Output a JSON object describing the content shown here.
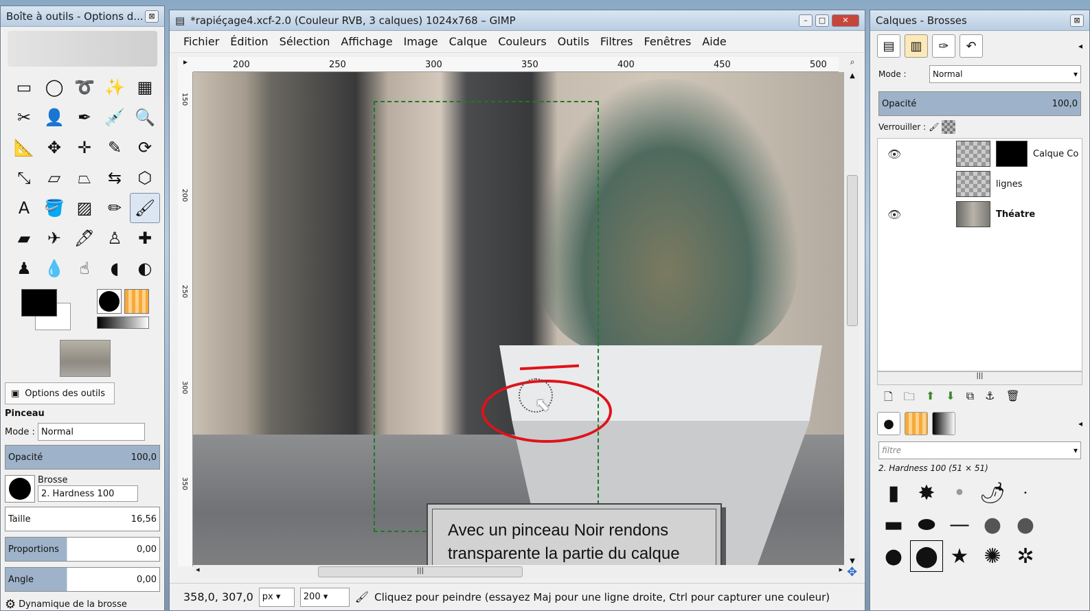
{
  "toolbox": {
    "title": "Boîte à outils - Options d...",
    "close": "⊠",
    "tools": [
      {
        "name": "rect-select-icon",
        "glyph": "▭"
      },
      {
        "name": "ellipse-select-icon",
        "glyph": "◯"
      },
      {
        "name": "lasso-icon",
        "glyph": "➰"
      },
      {
        "name": "fuzzy-select-icon",
        "glyph": "✨"
      },
      {
        "name": "color-select-icon",
        "glyph": "▦"
      },
      {
        "name": "scissors-icon",
        "glyph": "✂"
      },
      {
        "name": "foreground-select-icon",
        "glyph": "👤"
      },
      {
        "name": "paths-icon",
        "glyph": "✒"
      },
      {
        "name": "color-picker-icon",
        "glyph": "💉"
      },
      {
        "name": "zoom-icon",
        "glyph": "🔍"
      },
      {
        "name": "measure-icon",
        "glyph": "📐"
      },
      {
        "name": "move-icon",
        "glyph": "✥"
      },
      {
        "name": "align-icon",
        "glyph": "✛"
      },
      {
        "name": "crop-icon",
        "glyph": "✎"
      },
      {
        "name": "rotate-icon",
        "glyph": "⟳"
      },
      {
        "name": "scale-icon",
        "glyph": "⤡"
      },
      {
        "name": "shear-icon",
        "glyph": "▱"
      },
      {
        "name": "perspective-icon",
        "glyph": "⏢"
      },
      {
        "name": "flip-icon",
        "glyph": "⇆"
      },
      {
        "name": "cage-icon",
        "glyph": "⬡"
      },
      {
        "name": "text-icon",
        "glyph": "A"
      },
      {
        "name": "bucket-fill-icon",
        "glyph": "🪣"
      },
      {
        "name": "blend-icon",
        "glyph": "▨"
      },
      {
        "name": "pencil-icon",
        "glyph": "✏"
      },
      {
        "name": "paintbrush-icon",
        "glyph": "🖌"
      },
      {
        "name": "eraser-icon",
        "glyph": "▰"
      },
      {
        "name": "airbrush-icon",
        "glyph": "✈"
      },
      {
        "name": "ink-icon",
        "glyph": "🖋"
      },
      {
        "name": "clone-icon",
        "glyph": "♙"
      },
      {
        "name": "heal-icon",
        "glyph": "✚"
      },
      {
        "name": "perspective-clone-icon",
        "glyph": "♟"
      },
      {
        "name": "blur-icon",
        "glyph": "💧"
      },
      {
        "name": "smudge-icon",
        "glyph": "☝"
      },
      {
        "name": "dodge-burn-icon",
        "glyph": "◖"
      },
      {
        "name": "color-balance-icon",
        "glyph": "◐"
      }
    ],
    "active_tool_index": 24,
    "options_tab": "Options des outils",
    "tool_name": "Pinceau",
    "mode_label": "Mode :",
    "mode_value": "Normal",
    "opacity_label": "Opacité",
    "opacity_value": "100,0",
    "brush_label": "Brosse",
    "brush_value": "2. Hardness 100",
    "size_label": "Taille",
    "size_value": "16,56",
    "aspect_label": "Proportions",
    "aspect_value": "0,00",
    "angle_label": "Angle",
    "angle_value": "0,00",
    "dynamics_label": "Dynamique de la brosse"
  },
  "image_window": {
    "title": "*rapiéçage4.xcf-2.0 (Couleur RVB, 3 calques) 1024x768 – GIMP",
    "menu": [
      "Fichier",
      "Édition",
      "Sélection",
      "Affichage",
      "Image",
      "Calque",
      "Couleurs",
      "Outils",
      "Filtres",
      "Fenêtres",
      "Aide"
    ],
    "ruler_ticks": [
      "200",
      "250",
      "300",
      "350",
      "400",
      "450",
      "500"
    ],
    "ruler_v_ticks": [
      "150",
      "200",
      "250",
      "300",
      "350"
    ],
    "callout": "Avec un pinceau Noir rendons transparente la partie du calque souhaitée.",
    "status": {
      "coords": "358,0, 307,0",
      "unit": "px",
      "zoom": "200",
      "message": "Cliquez pour peindre (essayez Maj pour une ligne droite, Ctrl pour capturer une couleur)"
    }
  },
  "layers_panel": {
    "title": "Calques - Brosses",
    "close": "⊠",
    "mode_label": "Mode :",
    "mode_value": "Normal",
    "opacity_label": "Opacité",
    "opacity_value": "100,0",
    "lock_label": "Verrouiller :",
    "layers": [
      {
        "name": "Calque Co",
        "visible": true,
        "mask": true
      },
      {
        "name": "lignes",
        "visible": false,
        "mask": false
      },
      {
        "name": "Théatre",
        "visible": true,
        "mask": false
      }
    ],
    "filter_placeholder": "filtre",
    "brush_info": "2. Hardness 100 (51 × 51)"
  }
}
